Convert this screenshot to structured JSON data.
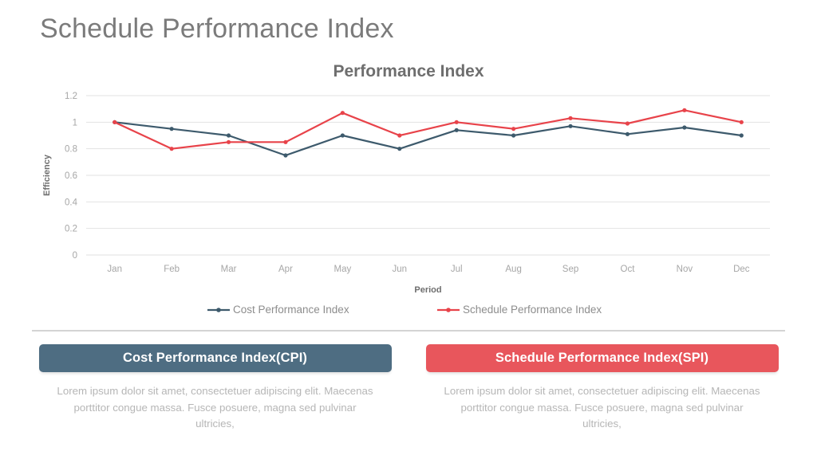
{
  "slide": {
    "title": "Schedule Performance Index"
  },
  "chart_data": {
    "type": "line",
    "title": "Performance Index",
    "xlabel": "Period",
    "ylabel": "Efficiency",
    "categories": [
      "Jan",
      "Feb",
      "Mar",
      "Apr",
      "May",
      "Jun",
      "Jul",
      "Aug",
      "Sep",
      "Oct",
      "Nov",
      "Dec"
    ],
    "series": [
      {
        "name": "Cost Performance Index",
        "color": "#3d5a6c",
        "values": [
          1.0,
          0.95,
          0.9,
          0.75,
          0.9,
          0.8,
          0.94,
          0.9,
          0.97,
          0.91,
          0.96,
          0.9
        ]
      },
      {
        "name": "Schedule Performance Index",
        "color": "#e8434a",
        "values": [
          1.0,
          0.8,
          0.85,
          0.85,
          1.07,
          0.9,
          1.0,
          0.95,
          1.03,
          0.99,
          1.09,
          1.0
        ]
      }
    ],
    "ylim": [
      0,
      1.2
    ],
    "yticks": [
      0,
      0.2,
      0.4,
      0.6,
      0.8,
      1,
      1.2
    ],
    "ytick_labels": [
      "0",
      "0.2",
      "0.4",
      "0.6",
      "0.8",
      "1",
      "1.2"
    ],
    "grid": true,
    "grid_color": "#e2e2e2",
    "legend_position": "bottom"
  },
  "columns": [
    {
      "pill_label": "Cost Performance Index(CPI)",
      "pill_color": "#4e6d82",
      "body": "Lorem ipsum dolor sit amet, consectetuer adipiscing elit. Maecenas porttitor congue massa. Fusce posuere, magna sed pulvinar ultricies,"
    },
    {
      "pill_label": "Schedule Performance Index(SPI)",
      "pill_color": "#e8565c",
      "body": "Lorem ipsum dolor sit amet, consectetuer adipiscing elit. Maecenas porttitor congue massa. Fusce posuere, magna sed pulvinar ultricies,"
    }
  ]
}
